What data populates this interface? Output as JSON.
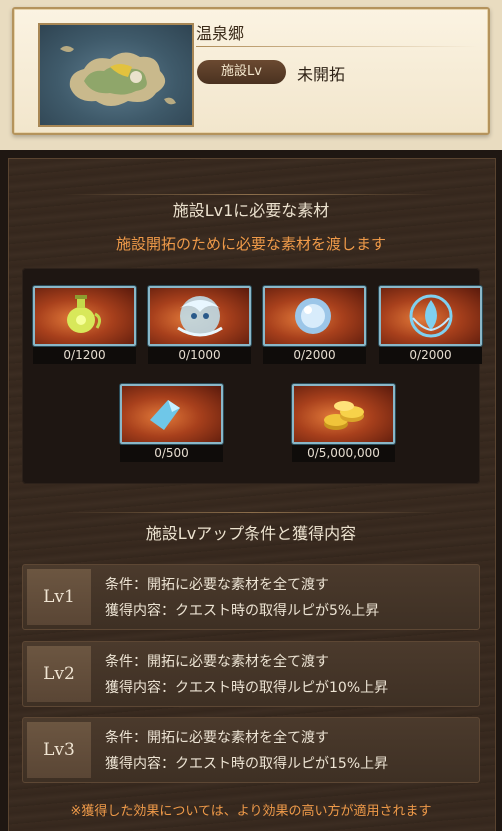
{
  "facility": {
    "name": "温泉郷",
    "lv_label": "施設Lv",
    "lv_value": "未開拓"
  },
  "materials": {
    "title": "施設Lv1に必要な素材",
    "subtitle": "施設開拓のために必要な素材を渡します",
    "items": [
      {
        "icon": "green-potion-flask-icon",
        "count": "0/1200"
      },
      {
        "icon": "water-spirit-creature-icon",
        "count": "0/1000"
      },
      {
        "icon": "crystal-orb-icon",
        "count": "0/2000"
      },
      {
        "icon": "water-drop-emblem-icon",
        "count": "0/2000"
      },
      {
        "icon": "blue-crystal-shard-icon",
        "count": "0/500"
      },
      {
        "icon": "gold-coins-icon",
        "count": "0/5,000,000"
      }
    ]
  },
  "levels": {
    "title": "施設Lvアップ条件と獲得内容",
    "rows": [
      {
        "lv": "Lv1",
        "condition": "条件：開拓に必要な素材を全て渡す",
        "reward": "獲得内容：クエスト時の取得ルピが5%上昇"
      },
      {
        "lv": "Lv2",
        "condition": "条件：開拓に必要な素材を全て渡す",
        "reward": "獲得内容：クエスト時の取得ルピが10%上昇"
      },
      {
        "lv": "Lv3",
        "condition": "条件：開拓に必要な素材を全て渡す",
        "reward": "獲得内容：クエスト時の取得ルピが15%上昇"
      }
    ]
  },
  "note": "※獲得した効果については、より効果の高い方が適用されます",
  "colors": {
    "accent_orange": "#ef9a49",
    "frame_blue": "#8ab7c8",
    "panel_brown": "#3a2b20",
    "header_cream": "#f2e6cc"
  }
}
